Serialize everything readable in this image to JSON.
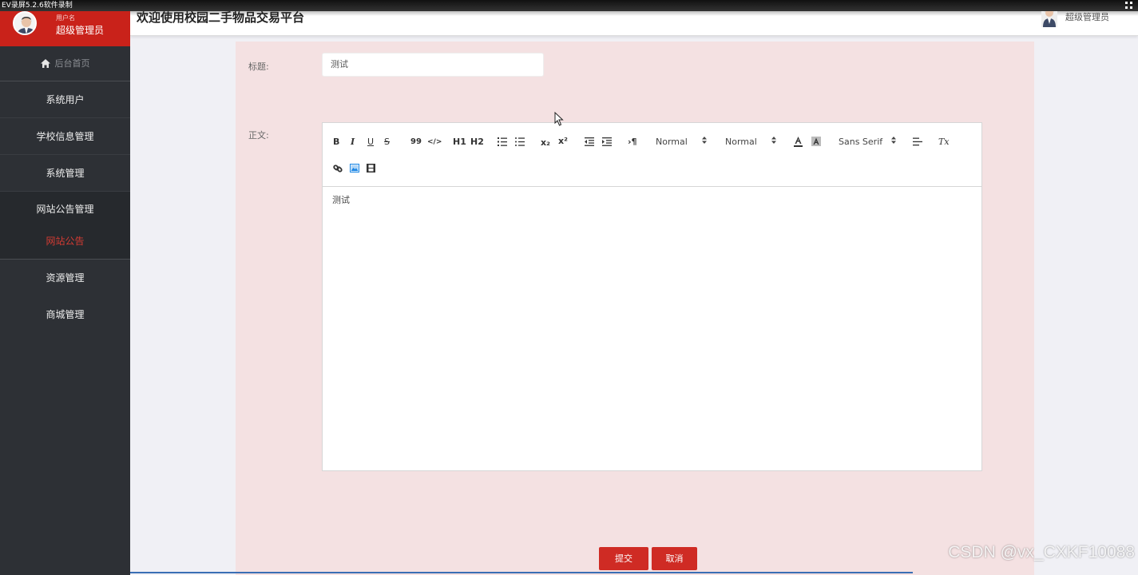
{
  "recorder": {
    "title": "EV录屏5.2.6软件录制"
  },
  "header": {
    "welcome": "欢迎使用校园二手物品交易平台",
    "user_name": "超级管理员"
  },
  "sidebar": {
    "user_label": "用户名",
    "user_name": "超级管理员",
    "home": "后台首页",
    "items": [
      "系统用户",
      "学校信息管理",
      "系统管理"
    ],
    "group": {
      "title": "网站公告管理",
      "active_sub": "网站公告"
    },
    "items_after": [
      "资源管理",
      "商城管理"
    ]
  },
  "form": {
    "title_label": "标题:",
    "title_value": "测试",
    "content_label": "正文:",
    "content_value": "测试",
    "submit": "提交",
    "cancel": "取消"
  },
  "toolbar": {
    "bold": "B",
    "italic": "I",
    "underline": "U",
    "strike": "S",
    "quote": "99",
    "code": "</>",
    "h1": "H1",
    "h2": "H2",
    "sub": "x₂",
    "sup": "x²",
    "direction": "›¶",
    "size1": "Normal",
    "size2": "Normal",
    "font": "Sans Serif",
    "clear": "Tx"
  },
  "watermark": "CSDN @vx_CXKF10088",
  "colors": {
    "sidebar_bg": "#2d3035",
    "brand_red": "#c9221a",
    "panel_bg": "#f4e1e2"
  }
}
